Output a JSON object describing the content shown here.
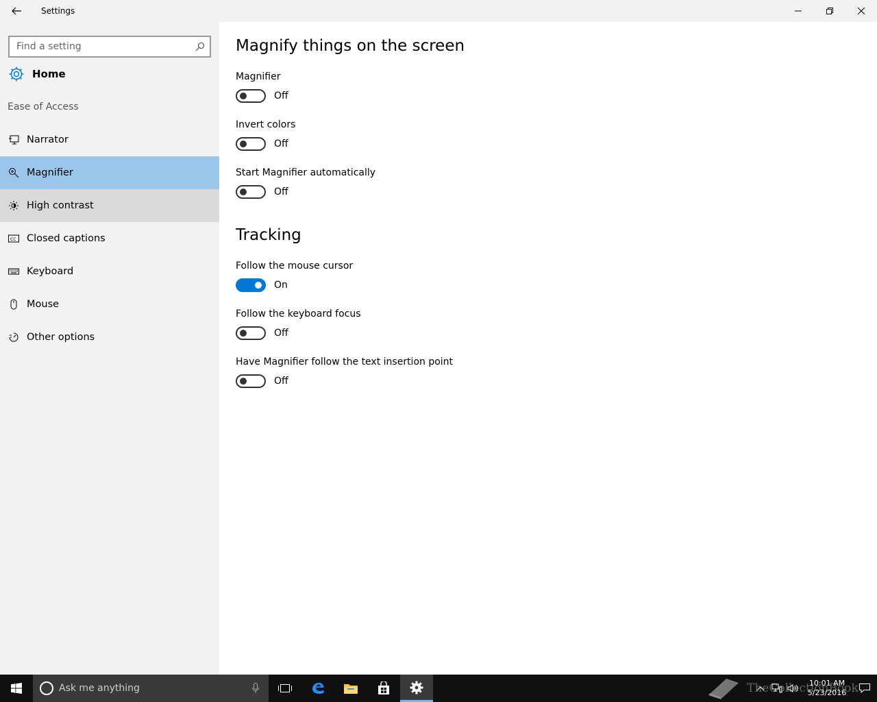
{
  "window": {
    "title": "Settings"
  },
  "sidebar": {
    "search_placeholder": "Find a setting",
    "home_label": "Home",
    "section_label": "Ease of Access",
    "items": [
      {
        "label": "Narrator",
        "icon": "narrator-icon"
      },
      {
        "label": "Magnifier",
        "icon": "magnifier-icon",
        "state": "selected"
      },
      {
        "label": "High contrast",
        "icon": "high-contrast-icon",
        "state": "hover"
      },
      {
        "label": "Closed captions",
        "icon": "closed-captions-icon"
      },
      {
        "label": "Keyboard",
        "icon": "keyboard-icon"
      },
      {
        "label": "Mouse",
        "icon": "mouse-icon"
      },
      {
        "label": "Other options",
        "icon": "other-options-icon"
      }
    ]
  },
  "content": {
    "heading_magnify": "Magnify things on the screen",
    "heading_tracking": "Tracking",
    "settings": [
      {
        "label": "Magnifier",
        "state": "Off",
        "on": false
      },
      {
        "label": "Invert colors",
        "state": "Off",
        "on": false
      },
      {
        "label": "Start Magnifier automatically",
        "state": "Off",
        "on": false
      },
      {
        "label": "Follow the mouse cursor",
        "state": "On",
        "on": true
      },
      {
        "label": "Follow the keyboard focus",
        "state": "Off",
        "on": false
      },
      {
        "label": "Have Magnifier follow the text insertion point",
        "state": "Off",
        "on": false
      }
    ]
  },
  "taskbar": {
    "search_text": "Ask me anything",
    "time": "10:01 AM",
    "date": "5/23/2016",
    "watermark": "TheCollectionBook"
  },
  "colors": {
    "accent": "#0078d7",
    "selected_bg": "#99c6ea",
    "hover_bg": "#dadada",
    "sidebar_bg": "#f2f2f2"
  }
}
